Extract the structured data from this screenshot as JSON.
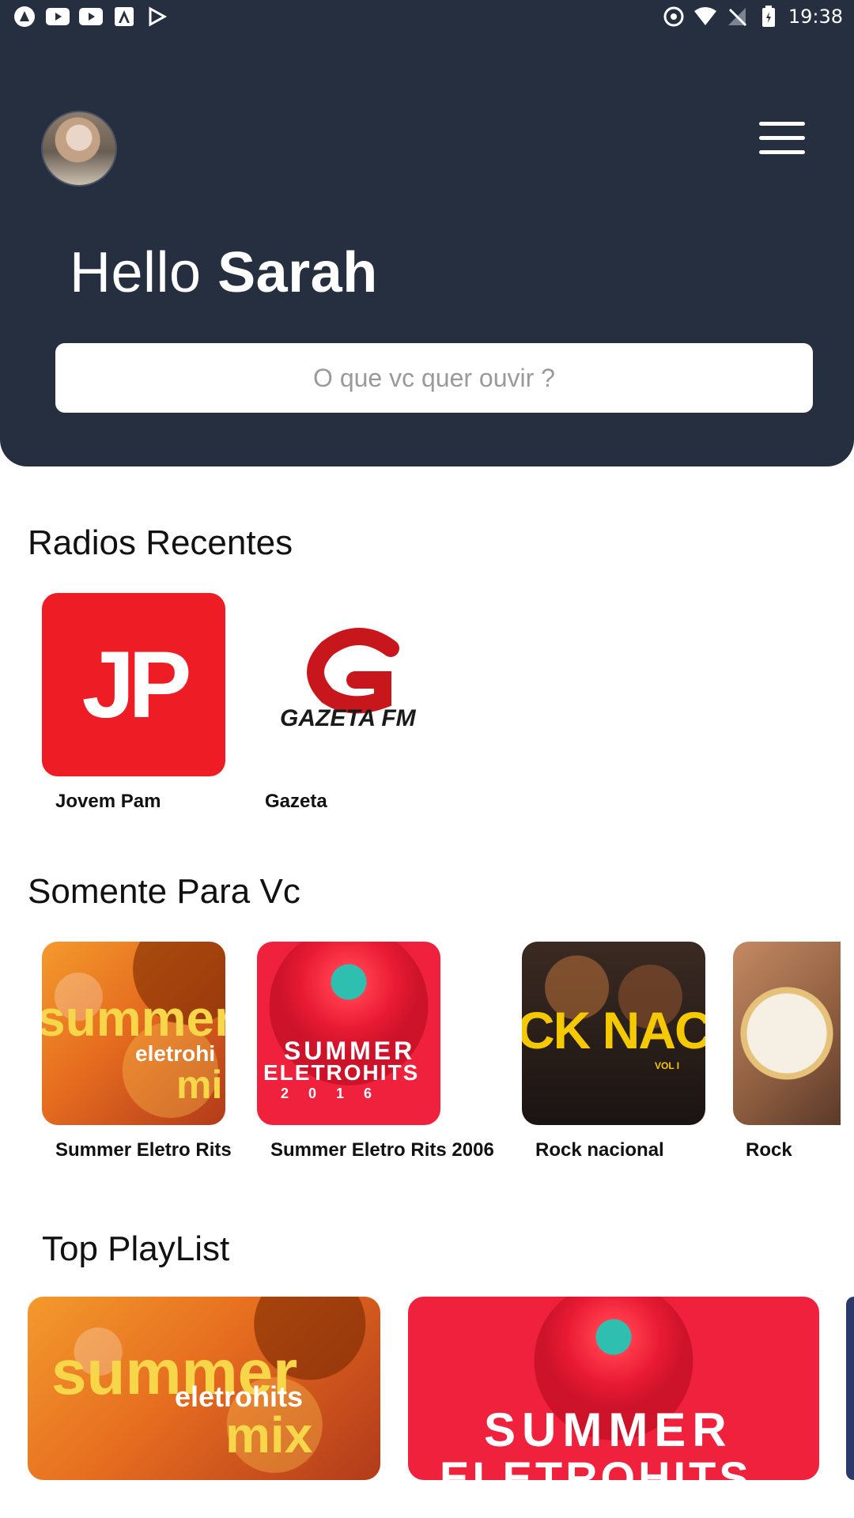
{
  "status_bar": {
    "time": "19:38",
    "left_icons": [
      "app-icon",
      "youtube-icon",
      "youtube-icon",
      "app-store-icon",
      "play-store-icon"
    ],
    "right_icons": [
      "sync-icon",
      "wifi-icon",
      "no-signal-icon",
      "battery-charging-icon"
    ]
  },
  "header": {
    "greeting_prefix": "Hello",
    "user_name": "Sarah",
    "search_placeholder": "O que vc quer ouvir ?",
    "background_color": "#262f40"
  },
  "recent_radios": {
    "title": "Radios Recentes",
    "items": [
      {
        "label": "Jovem Pam",
        "logo_text": "JP",
        "color": "#ee1c25"
      },
      {
        "label": "Gazeta",
        "logo_text": "GAZETA FM",
        "color": "#c8161d"
      }
    ]
  },
  "for_you": {
    "title": "Somente Para Vc",
    "items": [
      {
        "label": "Summer Eletro Rits",
        "art_text": "summer",
        "art_sub": "eletrohi",
        "art_sub2": "mi"
      },
      {
        "label": "Summer Eletro Rits 2006",
        "art_text": "SUMMER",
        "art_sub": "ELETROHITS",
        "art_sub2": "2 0 1 6"
      },
      {
        "label": "Rock nacional",
        "art_text": "CK NACION",
        "art_sub": "VOL I"
      },
      {
        "label": "Rock"
      }
    ]
  },
  "top_playlist": {
    "title": "Top PlayList",
    "items": [
      {
        "art_text": "summer",
        "art_sub": "eletrohits",
        "art_sub2": "mix"
      },
      {
        "art_text": "SUMMER",
        "art_sub": "ELETROHITS"
      }
    ]
  }
}
